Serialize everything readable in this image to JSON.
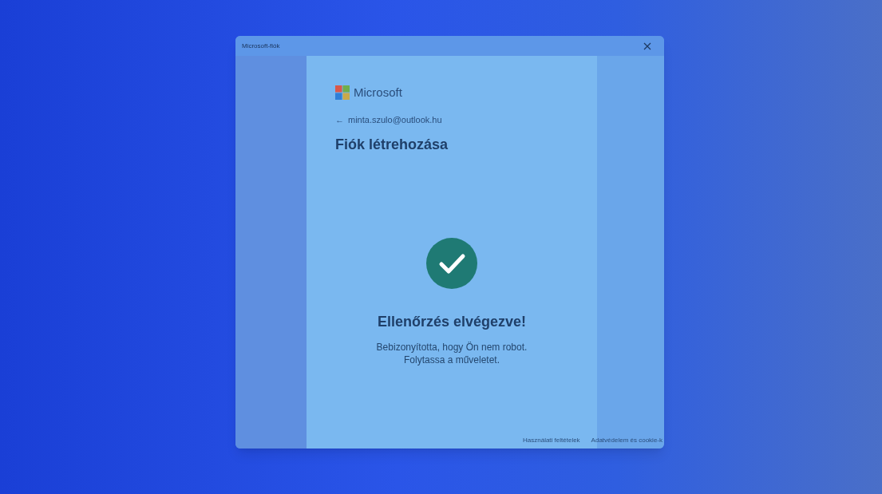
{
  "window": {
    "title": "Microsoft-fiók"
  },
  "brand": "Microsoft",
  "back": {
    "arrow": "←",
    "email": "minta.szulo@outlook.hu"
  },
  "heading": "Fiók létrehozása",
  "result": {
    "title": "Ellenőrzés elvégezve!",
    "lines": [
      "Bebizonyította, hogy Ön nem robot.",
      "Folytassa a műveletet."
    ]
  },
  "footer_links": [
    "Használati feltételek",
    "Adatvédelem és cookie-k"
  ]
}
